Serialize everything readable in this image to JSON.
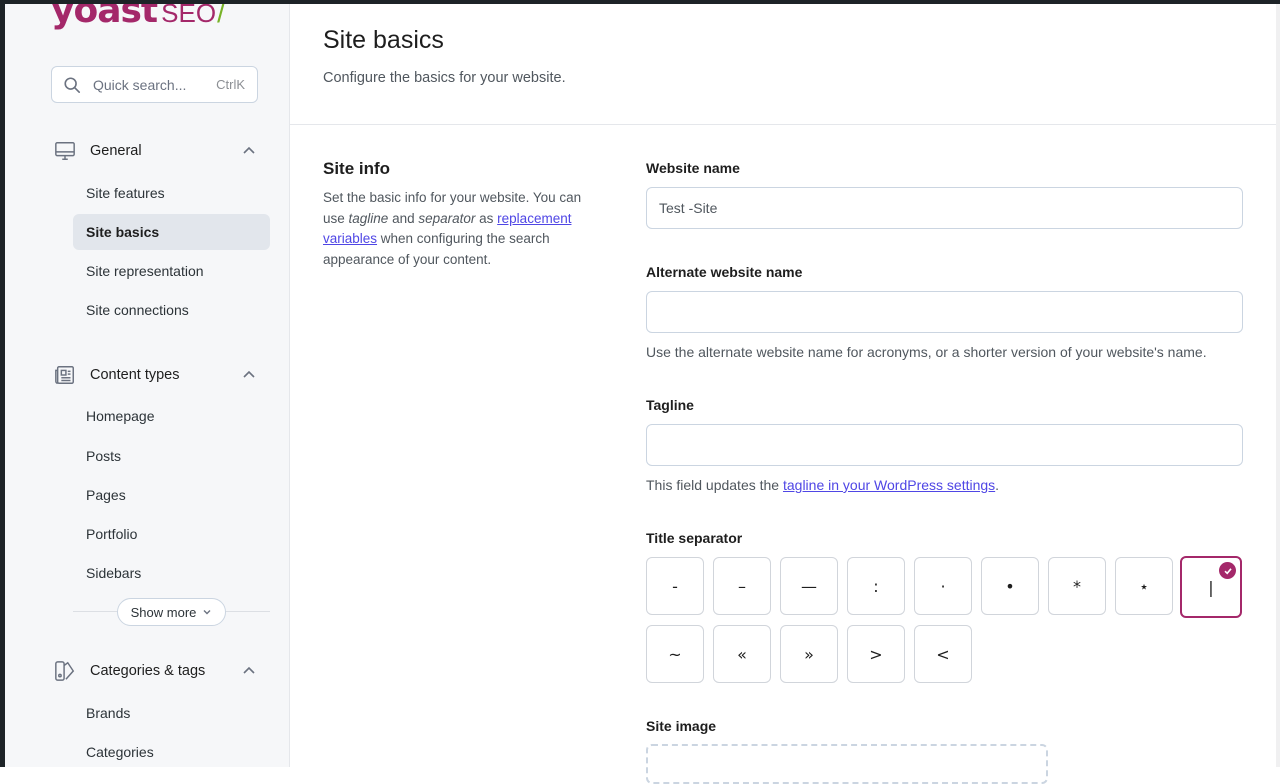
{
  "brand": {
    "logo_main": "yoast",
    "logo_suffix": "SEO",
    "logo_slash": "/",
    "accent": "#a4286a",
    "slash_color": "#77b227"
  },
  "search": {
    "placeholder": "Quick search...",
    "shortcut": "CtrlK",
    "icon": "search-icon"
  },
  "sidebar": {
    "groups": [
      {
        "label": "General",
        "icon": "desktop-icon",
        "items": [
          {
            "label": "Site features"
          },
          {
            "label": "Site basics",
            "active": true
          },
          {
            "label": "Site representation"
          },
          {
            "label": "Site connections"
          }
        ]
      },
      {
        "label": "Content types",
        "icon": "newspaper-icon",
        "items": [
          {
            "label": "Homepage"
          },
          {
            "label": "Posts"
          },
          {
            "label": "Pages"
          },
          {
            "label": "Portfolio"
          },
          {
            "label": "Sidebars"
          }
        ],
        "show_more": "Show more"
      },
      {
        "label": "Categories & tags",
        "icon": "tags-icon",
        "items": [
          {
            "label": "Brands"
          },
          {
            "label": "Categories"
          }
        ]
      }
    ]
  },
  "page": {
    "title": "Site basics",
    "description": "Configure the basics for your website."
  },
  "site_info": {
    "title": "Site info",
    "desc_1": "Set the basic info for your website. You can use ",
    "desc_tagline": "tagline",
    "desc_2": " and ",
    "desc_separator": "separator",
    "desc_3": " as ",
    "desc_link": "replacement variables",
    "desc_4": " when configuring the search appearance of your content."
  },
  "fields": {
    "website_name": {
      "label": "Website name",
      "value": "Test -Site"
    },
    "alternate_name": {
      "label": "Alternate website name",
      "value": "",
      "help": "Use the alternate website name for acronyms, or a shorter version of your website's name."
    },
    "tagline": {
      "label": "Tagline",
      "value": "",
      "help_1": "This field updates the ",
      "help_link": "tagline in your WordPress settings",
      "help_2": "."
    },
    "title_separator": {
      "label": "Title separator",
      "options": [
        "-",
        "–",
        "—",
        ":",
        "·",
        "•",
        "*",
        "⋆",
        "|",
        "~",
        "«",
        "»",
        ">",
        "<"
      ],
      "selected": "|"
    },
    "site_image": {
      "label": "Site image"
    }
  }
}
